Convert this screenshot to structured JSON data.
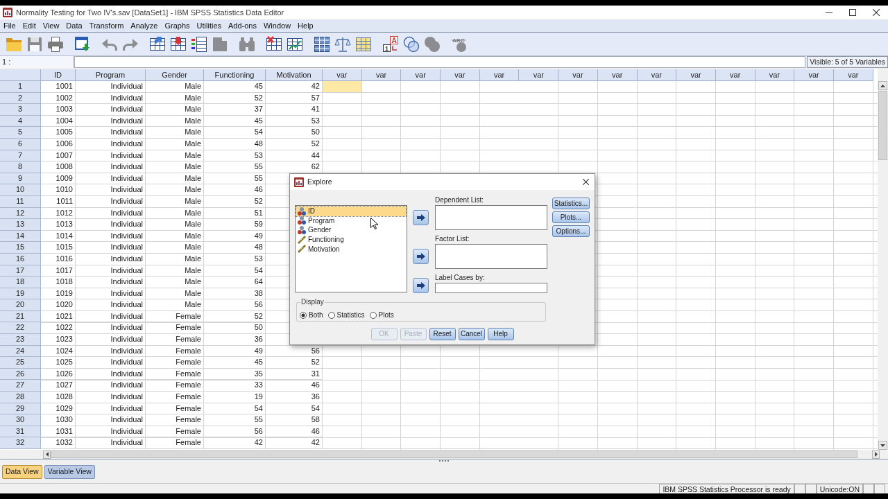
{
  "window": {
    "title": "Normality Testing for Two IV's.sav [DataSet1] - IBM SPSS Statistics Data Editor"
  },
  "menu_bar": [
    "File",
    "Edit",
    "View",
    "Data",
    "Transform",
    "Analyze",
    "Graphs",
    "Utilities",
    "Add-ons",
    "Window",
    "Help"
  ],
  "toolbar": [
    {
      "items": [
        {
          "kind": "open",
          "disabled": false
        },
        {
          "kind": "save",
          "disabled": true
        },
        {
          "kind": "print",
          "disabled": false
        }
      ]
    },
    {
      "items": [
        {
          "kind": "recall",
          "disabled": false
        }
      ]
    },
    {
      "items": [
        {
          "kind": "undo",
          "disabled": true
        },
        {
          "kind": "redo",
          "disabled": true
        }
      ]
    },
    {
      "items": [
        {
          "kind": "goto_case",
          "disabled": false
        },
        {
          "kind": "goto_variable",
          "disabled": false
        },
        {
          "kind": "variables",
          "disabled": false
        },
        {
          "kind": "document",
          "disabled": true
        }
      ]
    },
    {
      "items": [
        {
          "kind": "find",
          "disabled": true
        }
      ]
    },
    {
      "items": [
        {
          "kind": "insert_cases",
          "disabled": false
        },
        {
          "kind": "insert_variable",
          "disabled": false
        }
      ]
    },
    {
      "items": [
        {
          "kind": "split",
          "disabled": false
        },
        {
          "kind": "weight",
          "disabled": false
        },
        {
          "kind": "select",
          "disabled": false
        }
      ]
    },
    {
      "items": [
        {
          "kind": "value_labels",
          "disabled": false,
          "glyphs": [
            "A",
            "1"
          ]
        },
        {
          "kind": "use_sets",
          "disabled": false
        },
        {
          "kind": "show_all",
          "disabled": true
        }
      ]
    },
    {
      "items": [
        {
          "kind": "spell",
          "disabled": true,
          "glyphs": [
            "ABC"
          ]
        }
      ]
    }
  ],
  "cell_editor": {
    "reference": "1 :",
    "visible_count": "Visible: 5 of 5 Variables"
  },
  "grid": {
    "columns": [
      "ID",
      "Program",
      "Gender",
      "Functioning",
      "Motivation",
      "var",
      "var",
      "var",
      "var",
      "var",
      "var",
      "var",
      "var",
      "var",
      "var",
      "var",
      "var",
      "var",
      "var"
    ],
    "rows": [
      {
        "number": "1",
        "cells": [
          "1001",
          "Individual",
          "Male",
          "45",
          "42"
        ],
        "selected": true
      },
      {
        "number": "2",
        "cells": [
          "1002",
          "Individual",
          "Male",
          "52",
          "57"
        ],
        "selected": false
      },
      {
        "number": "3",
        "cells": [
          "1003",
          "Individual",
          "Male",
          "37",
          "41"
        ],
        "selected": false
      },
      {
        "number": "4",
        "cells": [
          "1004",
          "Individual",
          "Male",
          "45",
          "53"
        ],
        "selected": false
      },
      {
        "number": "5",
        "cells": [
          "1005",
          "Individual",
          "Male",
          "54",
          "50"
        ],
        "selected": false
      },
      {
        "number": "6",
        "cells": [
          "1006",
          "Individual",
          "Male",
          "48",
          "52"
        ],
        "selected": false
      },
      {
        "number": "7",
        "cells": [
          "1007",
          "Individual",
          "Male",
          "53",
          "44"
        ],
        "selected": false
      },
      {
        "number": "8",
        "cells": [
          "1008",
          "Individual",
          "Male",
          "55",
          "62"
        ],
        "selected": false
      },
      {
        "number": "9",
        "cells": [
          "1009",
          "Individual",
          "Male",
          "55"
        ]
      },
      {
        "number": "10",
        "cells": [
          "1010",
          "Individual",
          "Male",
          "46"
        ]
      },
      {
        "number": "11",
        "cells": [
          "1011",
          "Individual",
          "Male",
          "52"
        ]
      },
      {
        "number": "12",
        "cells": [
          "1012",
          "Individual",
          "Male",
          "51"
        ]
      },
      {
        "number": "13",
        "cells": [
          "1013",
          "Individual",
          "Male",
          "59"
        ]
      },
      {
        "number": "14",
        "cells": [
          "1014",
          "Individual",
          "Male",
          "49"
        ]
      },
      {
        "number": "15",
        "cells": [
          "1015",
          "Individual",
          "Male",
          "48"
        ]
      },
      {
        "number": "16",
        "cells": [
          "1016",
          "Individual",
          "Male",
          "53"
        ]
      },
      {
        "number": "17",
        "cells": [
          "1017",
          "Individual",
          "Male",
          "54"
        ]
      },
      {
        "number": "18",
        "cells": [
          "1018",
          "Individual",
          "Male",
          "64"
        ]
      },
      {
        "number": "19",
        "cells": [
          "1019",
          "Individual",
          "Male",
          "38"
        ]
      },
      {
        "number": "20",
        "cells": [
          "1020",
          "Individual",
          "Male",
          "56"
        ]
      },
      {
        "number": "21",
        "cells": [
          "1021",
          "Individual",
          "Female",
          "52"
        ]
      },
      {
        "number": "22",
        "cells": [
          "1022",
          "Individual",
          "Female",
          "50"
        ]
      },
      {
        "number": "23",
        "cells": [
          "1023",
          "Individual",
          "Female",
          "36"
        ]
      },
      {
        "number": "24",
        "cells": [
          "1024",
          "Individual",
          "Female",
          "49",
          "56"
        ],
        "selected": false
      },
      {
        "number": "25",
        "cells": [
          "1025",
          "Individual",
          "Female",
          "45",
          "52"
        ],
        "selected": false
      },
      {
        "number": "26",
        "cells": [
          "1026",
          "Individual",
          "Female",
          "35",
          "31"
        ],
        "selected": false
      },
      {
        "number": "27",
        "cells": [
          "1027",
          "Individual",
          "Female",
          "33",
          "46"
        ],
        "selected": false
      },
      {
        "number": "28",
        "cells": [
          "1028",
          "Individual",
          "Female",
          "19",
          "36"
        ],
        "selected": false
      },
      {
        "number": "29",
        "cells": [
          "1029",
          "Individual",
          "Female",
          "54",
          "54"
        ],
        "selected": false
      },
      {
        "number": "30",
        "cells": [
          "1030",
          "Individual",
          "Female",
          "55",
          "58"
        ],
        "selected": false
      },
      {
        "number": "31",
        "cells": [
          "1031",
          "Individual",
          "Female",
          "56",
          "46"
        ],
        "selected": false
      },
      {
        "number": "32",
        "cells": [
          "1032",
          "Individual",
          "Female",
          "42",
          "42"
        ],
        "selected": false
      }
    ]
  },
  "explore_dialog": {
    "title": "Explore",
    "variables": [
      {
        "name": "ID",
        "kind": "nominal",
        "selected": true
      },
      {
        "name": "Program",
        "kind": "nominal",
        "selected": false
      },
      {
        "name": "Gender",
        "kind": "nominal",
        "selected": false
      },
      {
        "name": "Functioning",
        "kind": "scale",
        "selected": false
      },
      {
        "name": "Motivation",
        "kind": "scale",
        "selected": false
      }
    ],
    "target_fields": [
      {
        "label": "Dependent List:",
        "kind": "list"
      },
      {
        "label": "Factor List:",
        "kind": "list"
      },
      {
        "label": "Label Cases by:",
        "kind": "single"
      }
    ],
    "side_buttons": [
      "Statistics...",
      "Plots...",
      "Options..."
    ],
    "display": {
      "label": "Display",
      "options": [
        {
          "label": "Both",
          "selected": true
        },
        {
          "label": "Statistics",
          "selected": false
        },
        {
          "label": "Plots",
          "selected": false
        }
      ]
    },
    "buttons": [
      {
        "label": "OK",
        "disabled": true
      },
      {
        "label": "Paste",
        "disabled": true
      },
      {
        "label": "Reset",
        "disabled": false
      },
      {
        "label": "Cancel",
        "disabled": false
      },
      {
        "label": "Help",
        "disabled": false
      }
    ]
  },
  "view_tabs": [
    {
      "label": "Data View",
      "selected": true
    },
    {
      "label": "Variable View",
      "selected": false
    }
  ],
  "status_bar": [
    "IBM SPSS Statistics Processor is ready",
    "Unicode:ON"
  ]
}
